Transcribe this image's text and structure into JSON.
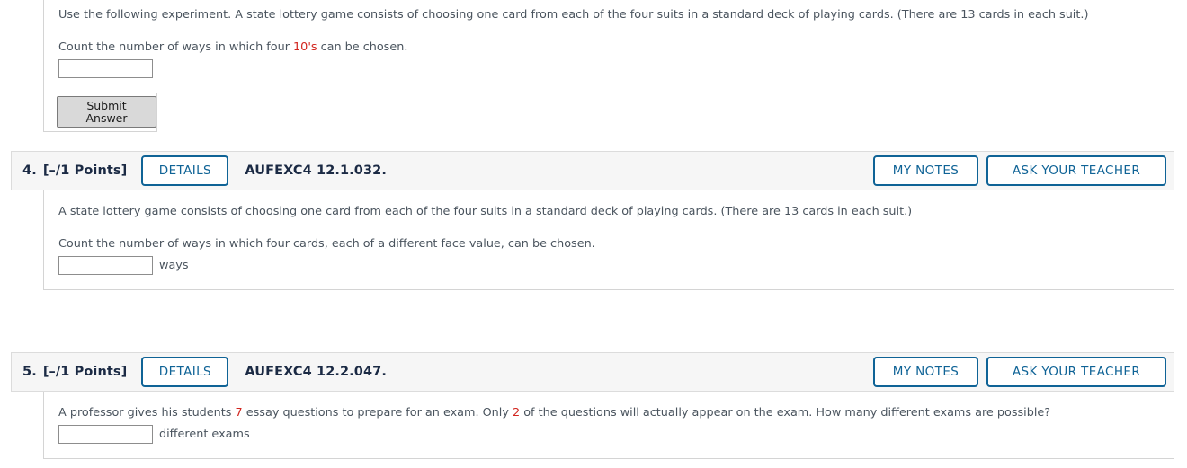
{
  "top_block": {
    "intro_text_prefix": "Use the following experiment. A state lottery game consists of choosing one card from each of the four suits in a standard deck of playing cards. (There are 13 cards in each suit.)",
    "prompt_prefix": "Count the number of ways in which four ",
    "prompt_highlight": "10's",
    "prompt_suffix": " can be chosen.",
    "answer_value": "",
    "submit_label": "Submit Answer"
  },
  "questions": [
    {
      "number": "4.",
      "points": "[–/1 Points]",
      "details_label": "DETAILS",
      "code": "AUFEXC4 12.1.032.",
      "my_notes_label": "MY NOTES",
      "ask_teacher_label": "ASK YOUR TEACHER",
      "intro_text": "A state lottery game consists of choosing one card from each of the four suits in a standard deck of playing cards. (There are 13 cards in each suit.)",
      "prompt_text": "Count the number of ways in which four cards, each of a different face value, can be chosen.",
      "answer_value": "",
      "unit_label": "ways"
    },
    {
      "number": "5.",
      "points": "[–/1 Points]",
      "details_label": "DETAILS",
      "code": "AUFEXC4 12.2.047.",
      "my_notes_label": "MY NOTES",
      "ask_teacher_label": "ASK YOUR TEACHER",
      "prompt_part1": "A professor gives his students ",
      "prompt_num1": "7",
      "prompt_part2": " essay questions to prepare for an exam. Only ",
      "prompt_num2": "2",
      "prompt_part3": " of the questions will actually appear on the exam. How many different exams are possible?",
      "answer_value": "",
      "unit_label": "different exams"
    }
  ],
  "colors": {
    "accent_blue": "#0f6396",
    "highlight_red": "#d2251e",
    "header_bg": "#f6f6f6",
    "text": "#4a545e"
  }
}
